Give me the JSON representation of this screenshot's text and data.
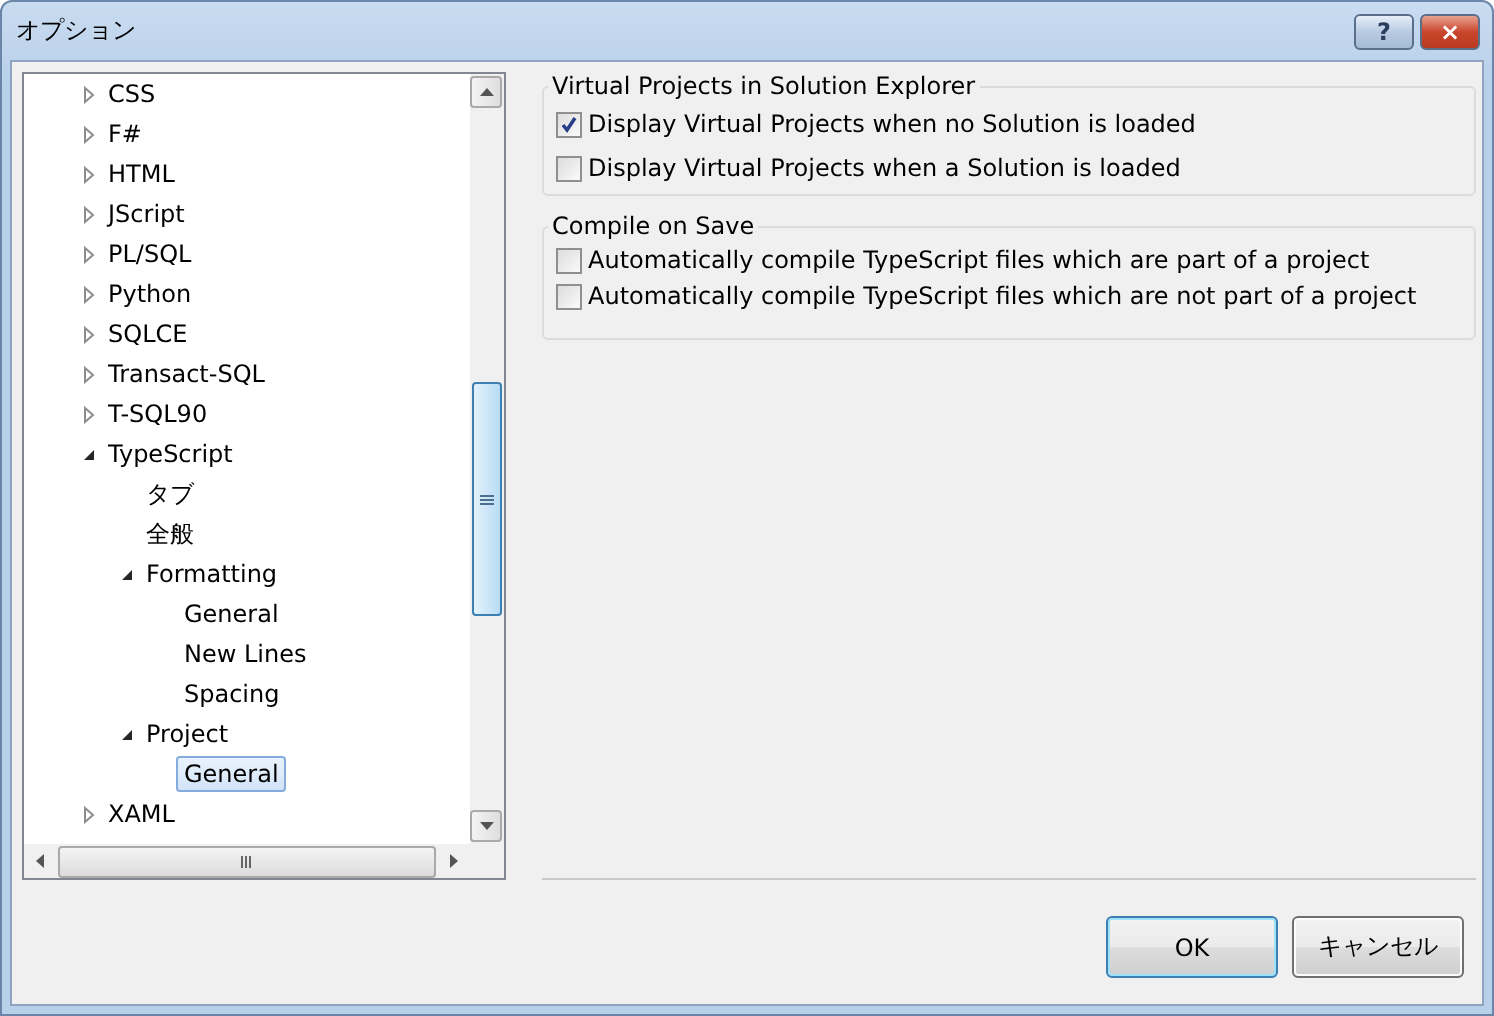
{
  "window": {
    "title": "オプション",
    "help_button": "?",
    "close_button": "×"
  },
  "tree": [
    {
      "label": "CSS",
      "expanded": false,
      "selected": false
    },
    {
      "label": "F#",
      "expanded": false,
      "selected": false
    },
    {
      "label": "HTML",
      "expanded": false,
      "selected": false
    },
    {
      "label": "JScript",
      "expanded": false,
      "selected": false
    },
    {
      "label": "PL/SQL",
      "expanded": false,
      "selected": false
    },
    {
      "label": "Python",
      "expanded": false,
      "selected": false
    },
    {
      "label": "SQLCE",
      "expanded": false,
      "selected": false
    },
    {
      "label": "Transact-SQL",
      "expanded": false,
      "selected": false
    },
    {
      "label": "T-SQL90",
      "expanded": false,
      "selected": false
    },
    {
      "label": "TypeScript",
      "expanded": true,
      "selected": false,
      "children": [
        {
          "label": "タブ",
          "selected": false
        },
        {
          "label": "全般",
          "selected": false
        },
        {
          "label": "Formatting",
          "expanded": true,
          "selected": false,
          "children": [
            {
              "label": "General",
              "selected": false
            },
            {
              "label": "New Lines",
              "selected": false
            },
            {
              "label": "Spacing",
              "selected": false
            }
          ]
        },
        {
          "label": "Project",
          "expanded": true,
          "selected": false,
          "children": [
            {
              "label": "General",
              "selected": true
            }
          ]
        }
      ]
    },
    {
      "label": "XAML",
      "expanded": false,
      "selected": false
    }
  ],
  "groups": [
    {
      "title": "Virtual Projects in Solution Explorer",
      "options": [
        {
          "label": "Display Virtual Projects when no Solution is loaded",
          "checked": true
        },
        {
          "label": "Display Virtual Projects when a Solution is loaded",
          "checked": false
        }
      ]
    },
    {
      "title": "Compile on Save",
      "options": [
        {
          "label": "Automatically compile TypeScript files which are part of a project",
          "checked": false
        },
        {
          "label": "Automatically compile TypeScript files which are not part of a project",
          "checked": false
        }
      ]
    }
  ],
  "buttons": [
    {
      "label": "OK",
      "default": true
    },
    {
      "label": "キャンセル",
      "default": false
    }
  ]
}
